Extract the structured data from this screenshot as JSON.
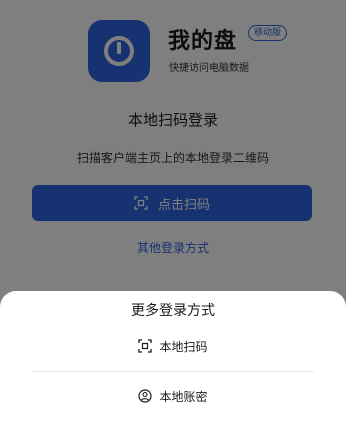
{
  "app": {
    "name": "我的盘",
    "badge": "移动版",
    "tagline": "快捷访问电脑数据",
    "brand_color": "#2f64e0"
  },
  "login": {
    "title": "本地扫码登录",
    "description": "扫描客户端主页上的本地登录二维码",
    "scan_button_label": "点击扫码",
    "other_login_link": "其他登录方式"
  },
  "sheet": {
    "title": "更多登录方式",
    "options": [
      {
        "label": "本地扫码",
        "icon": "scan-icon"
      },
      {
        "label": "本地账密",
        "icon": "account-icon"
      }
    ]
  }
}
